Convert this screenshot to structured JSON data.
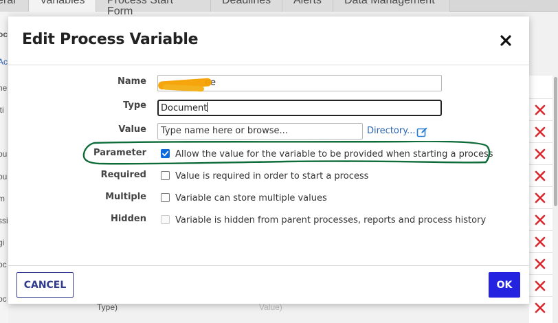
{
  "background": {
    "tabs": [
      {
        "label": "eral"
      },
      {
        "label": "Variables"
      },
      {
        "label": "Process Start Form"
      },
      {
        "label": "Deadlines"
      },
      {
        "label": "Alerts"
      },
      {
        "label": "Data Management"
      }
    ],
    "left_fragments": [
      "oc",
      "Ac",
      "ne",
      "iti",
      "ou",
      "ou",
      "m",
      "ssi",
      "gi",
      "oc",
      "oc"
    ],
    "bottom_fragments": [
      "Type)",
      "Value)"
    ],
    "delete_icon_count": 10
  },
  "dialog": {
    "title": "Edit Process Variable",
    "close_icon": "close-icon",
    "fields": {
      "name": {
        "label": "Name",
        "value": "ee"
      },
      "type": {
        "label": "Type",
        "value": "Document"
      },
      "value": {
        "label": "Value",
        "placeholder": "Type name here or browse...",
        "link": "Directory...",
        "link_icon": "edit-icon"
      }
    },
    "options": [
      {
        "label": "Parameter",
        "text": "Allow the value for the variable to be provided when starting a process",
        "checked": true,
        "disabled": false
      },
      {
        "label": "Required",
        "text": "Value is required in order to start a process",
        "checked": false,
        "disabled": false
      },
      {
        "label": "Multiple",
        "text": "Variable can store multiple values",
        "checked": false,
        "disabled": false
      },
      {
        "label": "Hidden",
        "text": "Variable is hidden from parent processes, reports and process history",
        "checked": false,
        "disabled": true
      }
    ],
    "buttons": {
      "cancel": "CANCEL",
      "ok": "OK"
    }
  },
  "colors": {
    "ok_button": "#2424e0",
    "cancel_border": "#2f3a8f",
    "checkbox_checked": "#0a6be0",
    "delete_icon": "#d9262b",
    "annotation": "#0e6b3a",
    "redaction": "#f5a000"
  }
}
